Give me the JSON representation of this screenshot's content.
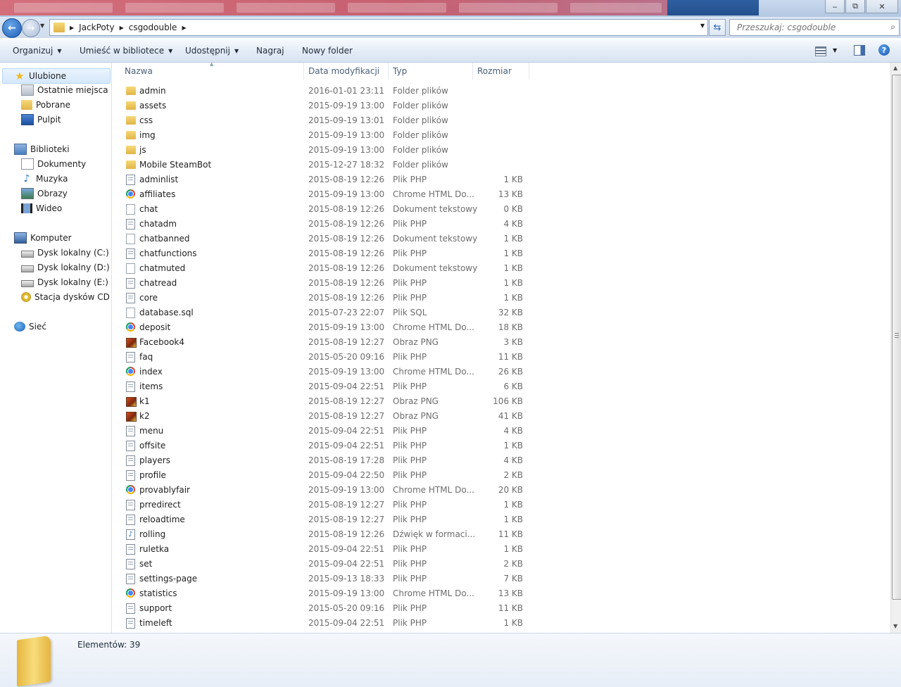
{
  "address": {
    "crumbs": [
      "JackPoty",
      "csgodouble"
    ]
  },
  "search": {
    "placeholder": "Przeszukaj: csgodouble"
  },
  "toolbar": {
    "organize": "Organizuj",
    "include_library": "Umieść w bibliotece",
    "share": "Udostępnij",
    "burn": "Nagraj",
    "new_folder": "Nowy folder"
  },
  "navpane": {
    "favorites": "Ulubione",
    "recent": "Ostatnie miejsca",
    "downloads": "Pobrane",
    "desktop": "Pulpit",
    "libraries": "Biblioteki",
    "documents": "Dokumenty",
    "music": "Muzyka",
    "pictures": "Obrazy",
    "videos": "Wideo",
    "computer": "Komputer",
    "drive_c": "Dysk lokalny (C:)",
    "drive_d": "Dysk lokalny (D:)",
    "drive_e": "Dysk lokalny (E:)",
    "cd_drive": "Stacja dysków CD (G",
    "network": "Sieć"
  },
  "columns": {
    "name": "Nazwa",
    "modified": "Data modyfikacji",
    "type": "Typ",
    "size": "Rozmiar"
  },
  "files": [
    {
      "name": "admin",
      "date": "2016-01-01 23:11",
      "type": "Folder plików",
      "size": "",
      "icon": "folder"
    },
    {
      "name": "assets",
      "date": "2015-09-19 13:00",
      "type": "Folder plików",
      "size": "",
      "icon": "folder"
    },
    {
      "name": "css",
      "date": "2015-09-19 13:01",
      "type": "Folder plików",
      "size": "",
      "icon": "folder"
    },
    {
      "name": "img",
      "date": "2015-09-19 13:00",
      "type": "Folder plików",
      "size": "",
      "icon": "folder"
    },
    {
      "name": "js",
      "date": "2015-09-19 13:00",
      "type": "Folder plików",
      "size": "",
      "icon": "folder"
    },
    {
      "name": "Mobile SteamBot",
      "date": "2015-12-27 18:32",
      "type": "Folder plików",
      "size": "",
      "icon": "folder"
    },
    {
      "name": "adminlist",
      "date": "2015-08-19 12:26",
      "type": "Plik PHP",
      "size": "1 KB",
      "icon": "file"
    },
    {
      "name": "affiliates",
      "date": "2015-09-19 13:00",
      "type": "Chrome HTML Do...",
      "size": "13 KB",
      "icon": "chrome"
    },
    {
      "name": "chat",
      "date": "2015-08-19 12:26",
      "type": "Dokument tekstowy",
      "size": "0 KB",
      "icon": "txt"
    },
    {
      "name": "chatadm",
      "date": "2015-08-19 12:26",
      "type": "Plik PHP",
      "size": "4 KB",
      "icon": "file"
    },
    {
      "name": "chatbanned",
      "date": "2015-08-19 12:26",
      "type": "Dokument tekstowy",
      "size": "1 KB",
      "icon": "txt"
    },
    {
      "name": "chatfunctions",
      "date": "2015-08-19 12:26",
      "type": "Plik PHP",
      "size": "1 KB",
      "icon": "file"
    },
    {
      "name": "chatmuted",
      "date": "2015-08-19 12:26",
      "type": "Dokument tekstowy",
      "size": "1 KB",
      "icon": "txt"
    },
    {
      "name": "chatread",
      "date": "2015-08-19 12:26",
      "type": "Plik PHP",
      "size": "1 KB",
      "icon": "file"
    },
    {
      "name": "core",
      "date": "2015-08-19 12:26",
      "type": "Plik PHP",
      "size": "1 KB",
      "icon": "file"
    },
    {
      "name": "database.sql",
      "date": "2015-07-23 22:07",
      "type": "Plik SQL",
      "size": "32 KB",
      "icon": "sql"
    },
    {
      "name": "deposit",
      "date": "2015-09-19 13:00",
      "type": "Chrome HTML Do...",
      "size": "18 KB",
      "icon": "chrome"
    },
    {
      "name": "Facebook4",
      "date": "2015-08-19 12:27",
      "type": "Obraz PNG",
      "size": "3 KB",
      "icon": "png"
    },
    {
      "name": "faq",
      "date": "2015-05-20 09:16",
      "type": "Plik PHP",
      "size": "11 KB",
      "icon": "file"
    },
    {
      "name": "index",
      "date": "2015-09-19 13:00",
      "type": "Chrome HTML Do...",
      "size": "26 KB",
      "icon": "chrome"
    },
    {
      "name": "items",
      "date": "2015-09-04 22:51",
      "type": "Plik PHP",
      "size": "6 KB",
      "icon": "file"
    },
    {
      "name": "k1",
      "date": "2015-08-19 12:27",
      "type": "Obraz PNG",
      "size": "106 KB",
      "icon": "png"
    },
    {
      "name": "k2",
      "date": "2015-08-19 12:27",
      "type": "Obraz PNG",
      "size": "41 KB",
      "icon": "png"
    },
    {
      "name": "menu",
      "date": "2015-09-04 22:51",
      "type": "Plik PHP",
      "size": "4 KB",
      "icon": "file"
    },
    {
      "name": "offsite",
      "date": "2015-09-04 22:51",
      "type": "Plik PHP",
      "size": "1 KB",
      "icon": "file"
    },
    {
      "name": "players",
      "date": "2015-08-19 17:28",
      "type": "Plik PHP",
      "size": "4 KB",
      "icon": "file"
    },
    {
      "name": "profile",
      "date": "2015-09-04 22:50",
      "type": "Plik PHP",
      "size": "2 KB",
      "icon": "file"
    },
    {
      "name": "provablyfair",
      "date": "2015-09-19 13:00",
      "type": "Chrome HTML Do...",
      "size": "20 KB",
      "icon": "chrome"
    },
    {
      "name": "prredirect",
      "date": "2015-08-19 12:27",
      "type": "Plik PHP",
      "size": "1 KB",
      "icon": "file"
    },
    {
      "name": "reloadtime",
      "date": "2015-08-19 12:27",
      "type": "Plik PHP",
      "size": "1 KB",
      "icon": "file"
    },
    {
      "name": "rolling",
      "date": "2015-08-19 12:26",
      "type": "Dźwięk w formaci...",
      "size": "11 KB",
      "icon": "audio"
    },
    {
      "name": "ruletka",
      "date": "2015-09-04 22:51",
      "type": "Plik PHP",
      "size": "1 KB",
      "icon": "file"
    },
    {
      "name": "set",
      "date": "2015-09-04 22:51",
      "type": "Plik PHP",
      "size": "2 KB",
      "icon": "file"
    },
    {
      "name": "settings-page",
      "date": "2015-09-13 18:33",
      "type": "Plik PHP",
      "size": "7 KB",
      "icon": "file"
    },
    {
      "name": "statistics",
      "date": "2015-09-19 13:00",
      "type": "Chrome HTML Do...",
      "size": "13 KB",
      "icon": "chrome"
    },
    {
      "name": "support",
      "date": "2015-05-20 09:16",
      "type": "Plik PHP",
      "size": "11 KB",
      "icon": "file"
    },
    {
      "name": "timeleft",
      "date": "2015-09-04 22:51",
      "type": "Plik PHP",
      "size": "1 KB",
      "icon": "file"
    }
  ],
  "status": {
    "count": "Elementów: 39"
  }
}
